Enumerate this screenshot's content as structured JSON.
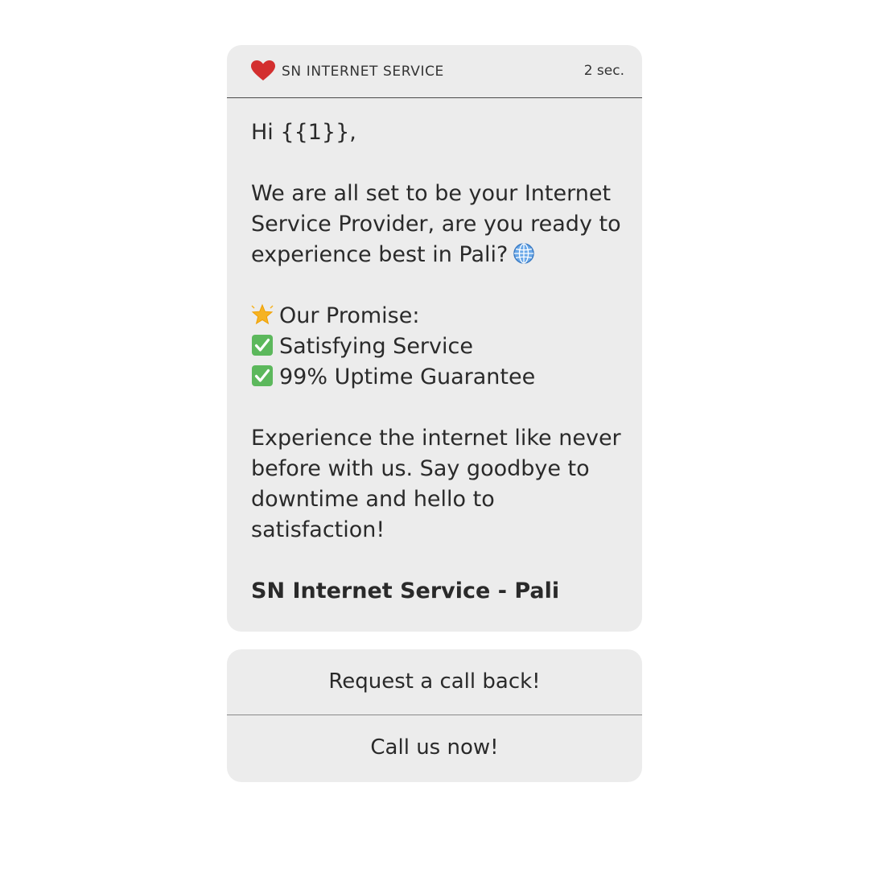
{
  "header": {
    "sender": "SN INTERNET SERVICE",
    "time": "2 sec.",
    "icon": "heart-icon",
    "icon_color": "#d32f2f"
  },
  "message": {
    "greeting": "Hi {{1}},",
    "intro_lines": [
      "We are all set to be your Internet",
      "Service Provider, are you ready to",
      "experience best in Pali?"
    ],
    "promise_title": "Our Promise:",
    "promise_items": [
      "Satisfying Service",
      "99% Uptime Guarantee"
    ],
    "outro_lines": [
      "Experience the internet like never",
      "before with us. Say goodbye to",
      "downtime and hello to",
      "satisfaction!"
    ],
    "signature": "SN Internet Service - Pali"
  },
  "buttons": {
    "callback": "Request a call back!",
    "call_now": "Call us now!"
  },
  "colors": {
    "card_bg": "#ececec",
    "check_green": "#4caf50",
    "star_yellow": "#f5b324",
    "globe_blue": "#4a90d9"
  }
}
